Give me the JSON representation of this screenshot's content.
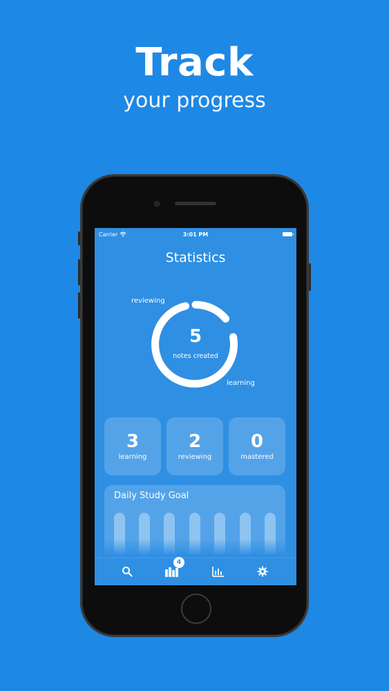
{
  "headline": "Track",
  "subline": "your progress",
  "status_bar": {
    "carrier": "Carrier",
    "time": "3:01 PM"
  },
  "screen": {
    "title": "Statistics",
    "donut": {
      "count": "5",
      "label": "notes created",
      "segments": [
        {
          "name": "reviewing",
          "value": 2
        },
        {
          "name": "learning",
          "value": 3
        }
      ],
      "tag_reviewing": "reviewing",
      "tag_learning": "learning"
    },
    "stats": [
      {
        "value": "3",
        "label": "learning"
      },
      {
        "value": "2",
        "label": "reviewing"
      },
      {
        "value": "0",
        "label": "mastered"
      }
    ],
    "goal": {
      "title": "Daily Study Goal",
      "bars": 7
    },
    "tabs": [
      {
        "icon": "search-icon"
      },
      {
        "icon": "library-icon",
        "badge": "4"
      },
      {
        "icon": "bar-chart-icon"
      },
      {
        "icon": "gear-icon"
      }
    ]
  }
}
